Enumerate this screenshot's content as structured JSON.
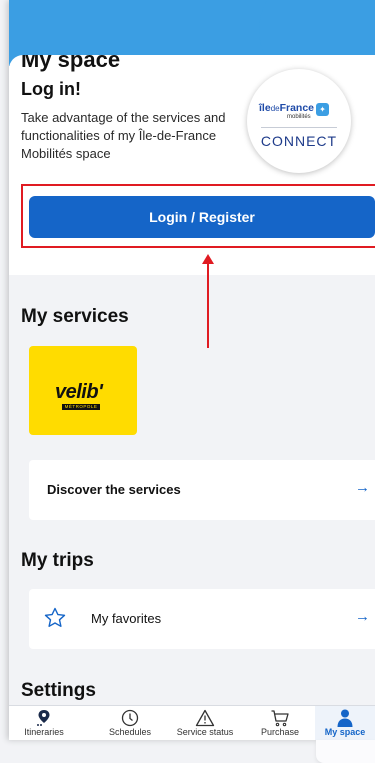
{
  "login": {
    "partial_heading": "My space",
    "title": "Log in!",
    "description": "Take advantage of the services and functionalities of my Île-de-France Mobilités space",
    "button_label": "Login / Register",
    "badge": {
      "brand_main": "île",
      "brand_de": "de",
      "brand_france": "France",
      "brand_sub": "mobilités",
      "connect_text": "CONNECT"
    }
  },
  "services": {
    "title": "My services",
    "velib": {
      "logo_text": "velib'",
      "logo_sub": "MÉTROPOLE"
    },
    "discover_label": "Discover the services",
    "arrow": "→"
  },
  "trips": {
    "title": "My trips",
    "favorites_label": "My favorites",
    "arrow": "→"
  },
  "settings": {
    "title": "Settings"
  },
  "nav": {
    "items": [
      {
        "label": "Itineraries",
        "icon": "location-pin-icon"
      },
      {
        "label": "Schedules",
        "icon": "clock-icon"
      },
      {
        "label": "Service status",
        "icon": "warning-icon"
      },
      {
        "label": "Purchase",
        "icon": "cart-icon"
      },
      {
        "label": "My space",
        "icon": "person-icon",
        "active": true
      }
    ]
  },
  "colors": {
    "brand_blue": "#1565c8",
    "header_blue": "#3b9ee3",
    "highlight_red": "#e01b22",
    "velib_yellow": "#ffdc00"
  }
}
